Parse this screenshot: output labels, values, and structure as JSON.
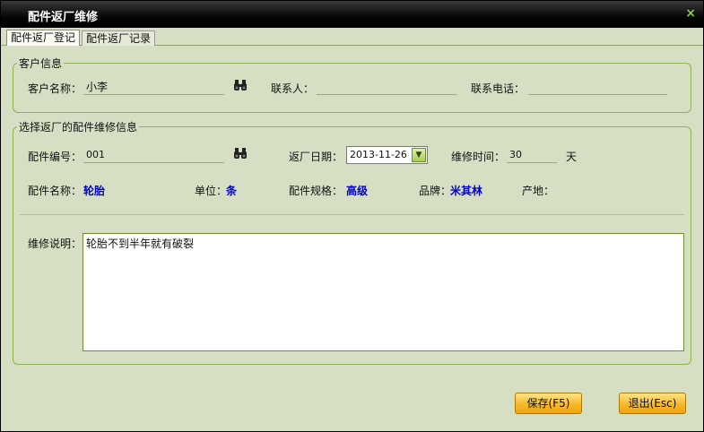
{
  "window": {
    "title": "配件返厂维修",
    "close_glyph": "×"
  },
  "tabs": [
    "配件返厂登记",
    "配件返厂记录"
  ],
  "customer": {
    "legend": "客户信息",
    "name_label": "客户名称：",
    "name_value": "小李",
    "contact_label": "联系人：",
    "contact_value": "",
    "phone_label": "联系电话：",
    "phone_value": ""
  },
  "part": {
    "legend": "选择返厂的配件维修信息",
    "code_label": "配件编号：",
    "code_value": "001",
    "return_date_label": "返厂日期：",
    "return_date_value": "2013-11-26",
    "repair_time_label": "维修时间：",
    "repair_time_value": "30",
    "repair_time_unit": "天",
    "part_name_label": "配件名称：",
    "part_name_value": "轮胎",
    "unit_label": "单位：",
    "unit_value": "条",
    "spec_label": "配件规格：",
    "spec_value": "高级",
    "brand_label": "品牌：",
    "brand_value": "米其林",
    "origin_label": "产地：",
    "origin_value": "",
    "desc_label": "维修说明：",
    "desc_value": "轮胎不到半年就有破裂"
  },
  "buttons": {
    "save": "保存(F5)",
    "exit": "退出(Esc)"
  },
  "icons": {
    "lookup": "binoculars-icon",
    "calendar_dropdown": "chevron-down-icon",
    "close": "close-icon"
  },
  "colors": {
    "title_bg": "#000000",
    "window_bg": "#d6dfc4",
    "value_text": "#0000cc",
    "button": "#f6b82a"
  }
}
